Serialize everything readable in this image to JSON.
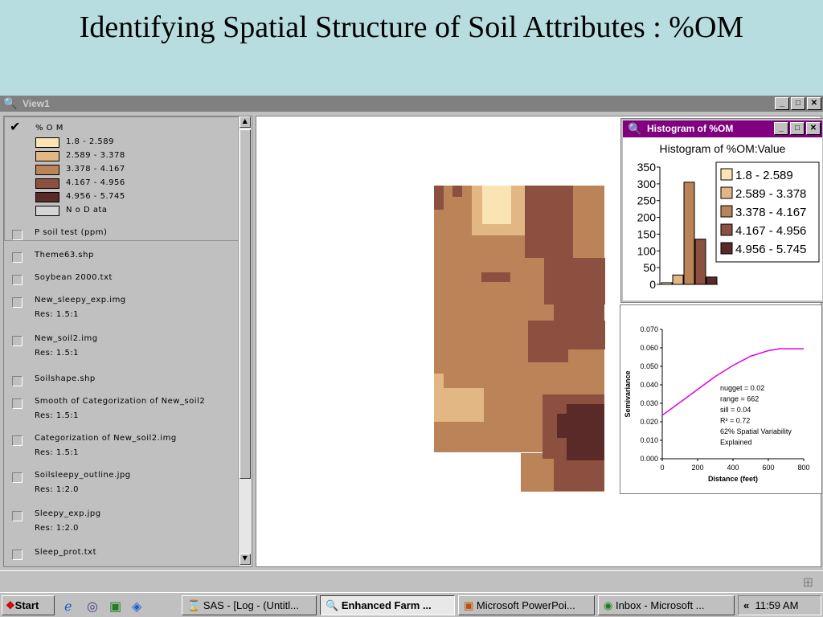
{
  "slide": {
    "title": "Identifying Spatial Structure of Soil Attributes : %OM"
  },
  "window": {
    "title": "View1",
    "btn_min": "_",
    "btn_max": "□",
    "btn_close": "✕"
  },
  "toc": {
    "active_theme": {
      "name": "% O M",
      "legend": [
        {
          "label": "1.8 - 2.589",
          "color": "#fbe4b4"
        },
        {
          "label": "2.589 - 3.378",
          "color": "#e2b784"
        },
        {
          "label": "3.378 - 4.167",
          "color": "#ba8358"
        },
        {
          "label": "4.167 - 4.956",
          "color": "#8b5040"
        },
        {
          "label": "4.956 - 5.745",
          "color": "#5a2a28"
        },
        {
          "label": "N o  D ata",
          "color": "#d4d4d4"
        }
      ]
    },
    "themes": [
      {
        "name": "P soil test (ppm)",
        "res": ""
      },
      {
        "name": "Theme63.shp",
        "res": ""
      },
      {
        "name": "Soybean 2000.txt",
        "res": ""
      },
      {
        "name": "New_sleepy_exp.img",
        "res": "Res: 1.5:1"
      },
      {
        "name": "New_soil2.img",
        "res": "Res: 1.5:1"
      },
      {
        "name": "Soilshape.shp",
        "res": ""
      },
      {
        "name": "Smooth of Categorization of New_soil2",
        "res": "Res: 1.5:1"
      },
      {
        "name": "Categorization of New_soil2.img",
        "res": "Res: 1.5:1"
      },
      {
        "name": "Soilsleepy_outline.jpg",
        "res": "Res: 1:2.0"
      },
      {
        "name": "Sleepy_exp.jpg",
        "res": "Res: 1:2.0"
      },
      {
        "name": "Sleep_prot.txt",
        "res": ""
      }
    ]
  },
  "histogram_window": {
    "title": "Histogram of %OM",
    "chart_title": "Histogram of %OM:Value",
    "yticks": [
      "350",
      "300",
      "250",
      "200",
      "150",
      "100",
      "50",
      "0"
    ],
    "legend": [
      "1.8 - 2.589",
      "2.589 - 3.378",
      "3.378 - 4.167",
      "4.167 - 4.956",
      "4.956 - 5.745"
    ]
  },
  "chart_data": {
    "type": "line",
    "title": "",
    "xlabel": "Distance (feet)",
    "ylabel": "Semivariance",
    "x": [
      0,
      100,
      200,
      300,
      400,
      500,
      600,
      662,
      700,
      800
    ],
    "y": [
      0.0235,
      0.0305,
      0.0375,
      0.0445,
      0.0505,
      0.0555,
      0.0585,
      0.0595,
      0.0595,
      0.0595
    ],
    "xlim": [
      0,
      800
    ],
    "ylim": [
      0,
      0.07
    ],
    "xticks": [
      "0",
      "200",
      "400",
      "600",
      "800"
    ],
    "yticks": [
      "0.000",
      "0.010",
      "0.020",
      "0.030",
      "0.040",
      "0.050",
      "0.060",
      "0.070"
    ],
    "annotations": [
      "nugget = 0.02",
      "range = 662",
      "sill = 0.04",
      "R² = 0.72",
      "62% Spatial Variability",
      "Explained"
    ],
    "line_color": "#e000e0"
  },
  "histogram_data": {
    "type": "bar",
    "categories": [
      "1.8 - 2.589",
      "2.589 - 3.378",
      "3.378 - 4.167",
      "4.167 - 4.956",
      "4.956 - 5.745"
    ],
    "values": [
      5,
      28,
      305,
      135,
      22
    ],
    "ylim": [
      0,
      350
    ]
  },
  "taskbar": {
    "start": "Start",
    "tasks": [
      {
        "label": "SAS - [Log - (Untitl...",
        "icon": "hourglass-icon",
        "active": false
      },
      {
        "label": "Enhanced Farm ...",
        "icon": "globe-magnifier-icon",
        "active": true
      },
      {
        "label": "Microsoft PowerPoi...",
        "icon": "powerpoint-icon",
        "active": false
      },
      {
        "label": "Inbox - Microsoft ...",
        "icon": "outlook-icon",
        "active": false
      }
    ],
    "clock": "11:59 AM",
    "tray_arrow": "«"
  }
}
